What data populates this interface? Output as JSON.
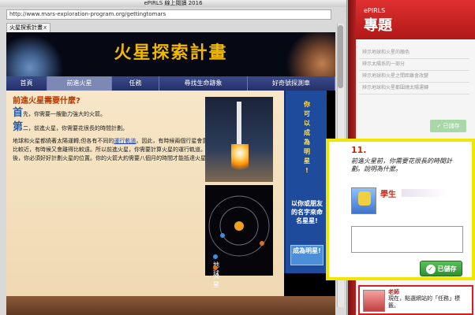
{
  "browser": {
    "window_title": "ePIRLS 線上閱讀 2016",
    "url": "http://www.mars-exploration-program.org/gettingtomars",
    "tab_label": "火星探索計畫",
    "tab_close": "x"
  },
  "site": {
    "banner_title": "火星探索計畫",
    "nav": [
      {
        "label": "首頁"
      },
      {
        "label": "前進火星"
      },
      {
        "label": "任務"
      },
      {
        "label": "尋找生命跡象"
      },
      {
        "label": "好奇號探測車"
      }
    ],
    "heading": "前進火星需要什麼?",
    "p1_big": "首",
    "p1_rest": "先，你需要一艘動力強大的火箭。",
    "p2_big": "第",
    "p2_rest": "二，前進火星，你需要花很長的時間計劃。",
    "p3_before": "地球和火星都繞著太陽運轉;但各有不同的",
    "p3_link": "運行軌道",
    "p3_after": "。因此，有時候兩個行星會靠得比較近，有時候又會離得比較遠。所以前進火星，你需要計算火星的運行軌道。然後，你必須好好計劃火星的位置。你的火箭大約需要八個月的時間才能抵達火星。",
    "legend_earth": "地球",
    "legend_mars": "火星",
    "promo_chars": [
      "你",
      "可",
      "以",
      "成",
      "為",
      "明",
      "星",
      "!"
    ],
    "promo_sub": "以你或朋友的名字來命名星星!",
    "promo_button": "成為明星!",
    "colors": {
      "earth": "#3a8fe0",
      "mars": "#e07020",
      "accent": "#f0b800"
    }
  },
  "panel": {
    "logo": "ePIRLS",
    "title": "專題",
    "notes": [
      "辨示地球和火星的顏色",
      "辨示太陽系的一部分",
      "辨示地球和火星之間距離會改變",
      "辨示地球和火星都圍繞太陽運轉"
    ],
    "saved_label": "已儲存",
    "question_number": "11.",
    "question_text": "前進火星前，你需要花很長的時間計劃。說明為什麼。",
    "student_label": "學生",
    "answer_value": "",
    "save_button_label": "已儲存",
    "teacher_label": "老師",
    "teacher_msg": "現在，點選網站的「任務」標籤。"
  }
}
